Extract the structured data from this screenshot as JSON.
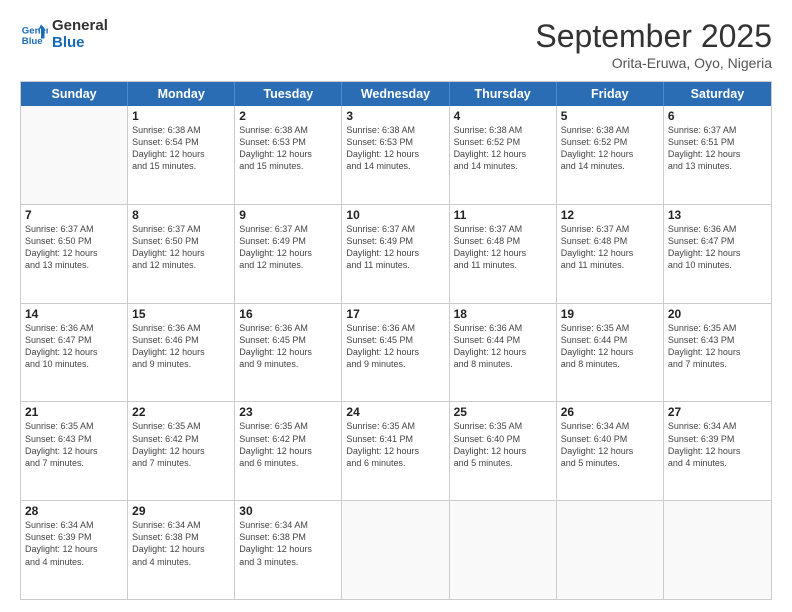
{
  "logo": {
    "line1": "General",
    "line2": "Blue"
  },
  "title": "September 2025",
  "subtitle": "Orita-Eruwa, Oyo, Nigeria",
  "days": [
    "Sunday",
    "Monday",
    "Tuesday",
    "Wednesday",
    "Thursday",
    "Friday",
    "Saturday"
  ],
  "weeks": [
    [
      {
        "day": "",
        "info": ""
      },
      {
        "day": "1",
        "info": "Sunrise: 6:38 AM\nSunset: 6:54 PM\nDaylight: 12 hours\nand 15 minutes."
      },
      {
        "day": "2",
        "info": "Sunrise: 6:38 AM\nSunset: 6:53 PM\nDaylight: 12 hours\nand 15 minutes."
      },
      {
        "day": "3",
        "info": "Sunrise: 6:38 AM\nSunset: 6:53 PM\nDaylight: 12 hours\nand 14 minutes."
      },
      {
        "day": "4",
        "info": "Sunrise: 6:38 AM\nSunset: 6:52 PM\nDaylight: 12 hours\nand 14 minutes."
      },
      {
        "day": "5",
        "info": "Sunrise: 6:38 AM\nSunset: 6:52 PM\nDaylight: 12 hours\nand 14 minutes."
      },
      {
        "day": "6",
        "info": "Sunrise: 6:37 AM\nSunset: 6:51 PM\nDaylight: 12 hours\nand 13 minutes."
      }
    ],
    [
      {
        "day": "7",
        "info": "Sunrise: 6:37 AM\nSunset: 6:50 PM\nDaylight: 12 hours\nand 13 minutes."
      },
      {
        "day": "8",
        "info": "Sunrise: 6:37 AM\nSunset: 6:50 PM\nDaylight: 12 hours\nand 12 minutes."
      },
      {
        "day": "9",
        "info": "Sunrise: 6:37 AM\nSunset: 6:49 PM\nDaylight: 12 hours\nand 12 minutes."
      },
      {
        "day": "10",
        "info": "Sunrise: 6:37 AM\nSunset: 6:49 PM\nDaylight: 12 hours\nand 11 minutes."
      },
      {
        "day": "11",
        "info": "Sunrise: 6:37 AM\nSunset: 6:48 PM\nDaylight: 12 hours\nand 11 minutes."
      },
      {
        "day": "12",
        "info": "Sunrise: 6:37 AM\nSunset: 6:48 PM\nDaylight: 12 hours\nand 11 minutes."
      },
      {
        "day": "13",
        "info": "Sunrise: 6:36 AM\nSunset: 6:47 PM\nDaylight: 12 hours\nand 10 minutes."
      }
    ],
    [
      {
        "day": "14",
        "info": "Sunrise: 6:36 AM\nSunset: 6:47 PM\nDaylight: 12 hours\nand 10 minutes."
      },
      {
        "day": "15",
        "info": "Sunrise: 6:36 AM\nSunset: 6:46 PM\nDaylight: 12 hours\nand 9 minutes."
      },
      {
        "day": "16",
        "info": "Sunrise: 6:36 AM\nSunset: 6:45 PM\nDaylight: 12 hours\nand 9 minutes."
      },
      {
        "day": "17",
        "info": "Sunrise: 6:36 AM\nSunset: 6:45 PM\nDaylight: 12 hours\nand 9 minutes."
      },
      {
        "day": "18",
        "info": "Sunrise: 6:36 AM\nSunset: 6:44 PM\nDaylight: 12 hours\nand 8 minutes."
      },
      {
        "day": "19",
        "info": "Sunrise: 6:35 AM\nSunset: 6:44 PM\nDaylight: 12 hours\nand 8 minutes."
      },
      {
        "day": "20",
        "info": "Sunrise: 6:35 AM\nSunset: 6:43 PM\nDaylight: 12 hours\nand 7 minutes."
      }
    ],
    [
      {
        "day": "21",
        "info": "Sunrise: 6:35 AM\nSunset: 6:43 PM\nDaylight: 12 hours\nand 7 minutes."
      },
      {
        "day": "22",
        "info": "Sunrise: 6:35 AM\nSunset: 6:42 PM\nDaylight: 12 hours\nand 7 minutes."
      },
      {
        "day": "23",
        "info": "Sunrise: 6:35 AM\nSunset: 6:42 PM\nDaylight: 12 hours\nand 6 minutes."
      },
      {
        "day": "24",
        "info": "Sunrise: 6:35 AM\nSunset: 6:41 PM\nDaylight: 12 hours\nand 6 minutes."
      },
      {
        "day": "25",
        "info": "Sunrise: 6:35 AM\nSunset: 6:40 PM\nDaylight: 12 hours\nand 5 minutes."
      },
      {
        "day": "26",
        "info": "Sunrise: 6:34 AM\nSunset: 6:40 PM\nDaylight: 12 hours\nand 5 minutes."
      },
      {
        "day": "27",
        "info": "Sunrise: 6:34 AM\nSunset: 6:39 PM\nDaylight: 12 hours\nand 4 minutes."
      }
    ],
    [
      {
        "day": "28",
        "info": "Sunrise: 6:34 AM\nSunset: 6:39 PM\nDaylight: 12 hours\nand 4 minutes."
      },
      {
        "day": "29",
        "info": "Sunrise: 6:34 AM\nSunset: 6:38 PM\nDaylight: 12 hours\nand 4 minutes."
      },
      {
        "day": "30",
        "info": "Sunrise: 6:34 AM\nSunset: 6:38 PM\nDaylight: 12 hours\nand 3 minutes."
      },
      {
        "day": "",
        "info": ""
      },
      {
        "day": "",
        "info": ""
      },
      {
        "day": "",
        "info": ""
      },
      {
        "day": "",
        "info": ""
      }
    ]
  ]
}
